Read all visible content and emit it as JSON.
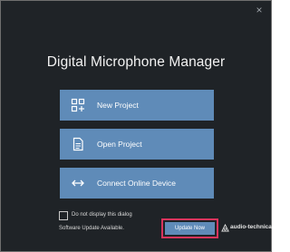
{
  "dialog": {
    "title": "Digital Microphone Manager",
    "close_glyph": "×"
  },
  "actions": [
    {
      "label": "New Project",
      "icon": "new-project-icon"
    },
    {
      "label": "Open Project",
      "icon": "document-icon"
    },
    {
      "label": "Connect Online Device",
      "icon": "bidirectional-arrow-icon"
    }
  ],
  "footer": {
    "checkbox_label": "Do not display this dialog",
    "checkbox_checked": false,
    "update_message": "Software Update Available.",
    "update_button_label": "Update Now",
    "brand": "audio-technica"
  },
  "colors": {
    "background": "#1f2327",
    "button": "#5f8bb8",
    "highlight": "#d9345d"
  }
}
